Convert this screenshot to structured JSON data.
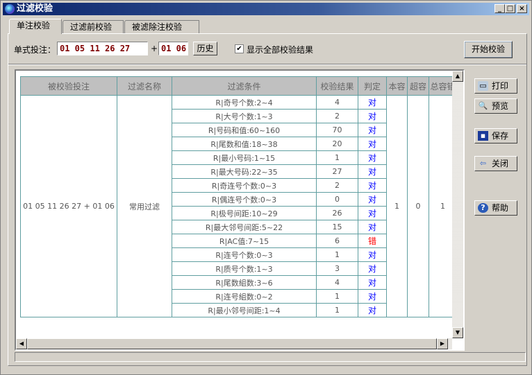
{
  "window": {
    "title": "过滤校验",
    "min": "_",
    "max": "□",
    "close": "×"
  },
  "tabs": [
    {
      "label": "单注校验",
      "active": true
    },
    {
      "label": "过滤前校验",
      "active": false
    },
    {
      "label": "被滤除注校验",
      "active": false
    }
  ],
  "form": {
    "bet_label": "单式投注：",
    "front_numbers": "01 05 11 26 27",
    "plus": "+",
    "back_numbers": "01 06",
    "history_button": "历史",
    "show_all_label": "显示全部校验结果",
    "show_all_checked": true,
    "show_all_check": "✔",
    "start_button": "开始校验"
  },
  "table": {
    "headers": [
      "被校验投注",
      "过滤名称",
      "过滤条件",
      "校验结果",
      "判定",
      "本容",
      "超容",
      "总容错"
    ],
    "bet": "01 05 11 26 27 + 01 06",
    "filter_name": "常用过滤",
    "rows": [
      {
        "condition": "R|奇号个数:2~4",
        "result": "4",
        "verdict": "对"
      },
      {
        "condition": "R|大号个数:1~3",
        "result": "2",
        "verdict": "对"
      },
      {
        "condition": "R|号码和值:60~160",
        "result": "70",
        "verdict": "对"
      },
      {
        "condition": "R|尾数和值:18~38",
        "result": "20",
        "verdict": "对"
      },
      {
        "condition": "R|最小号码:1~15",
        "result": "1",
        "verdict": "对"
      },
      {
        "condition": "R|最大号码:22~35",
        "result": "27",
        "verdict": "对"
      },
      {
        "condition": "R|奇连号个数:0~3",
        "result": "2",
        "verdict": "对"
      },
      {
        "condition": "R|偶连号个数:0~3",
        "result": "0",
        "verdict": "对"
      },
      {
        "condition": "R|极号间距:10~29",
        "result": "26",
        "verdict": "对"
      },
      {
        "condition": "R|最大邻号间距:5~22",
        "result": "15",
        "verdict": "对"
      },
      {
        "condition": "R|AC值:7~15",
        "result": "6",
        "verdict": "错"
      },
      {
        "condition": "R|连号个数:0~3",
        "result": "1",
        "verdict": "对"
      },
      {
        "condition": "R|质号个数:1~3",
        "result": "3",
        "verdict": "对"
      },
      {
        "condition": "R|尾数組数:3~6",
        "result": "4",
        "verdict": "对"
      },
      {
        "condition": "R|连号組数:0~2",
        "result": "1",
        "verdict": "对"
      },
      {
        "condition": "R|最小邻号间距:1~4",
        "result": "1",
        "verdict": "对"
      }
    ],
    "within": "1",
    "exceed": "0",
    "total_tolerance": "1"
  },
  "buttons": {
    "print": "打印",
    "preview": "预览",
    "save": "保存",
    "close": "关闭",
    "help": "帮助"
  },
  "colors": {
    "ok": "#0000ff",
    "bad": "#ff0000",
    "grid_line": "#5f9ea0",
    "input_text": "#800000"
  }
}
